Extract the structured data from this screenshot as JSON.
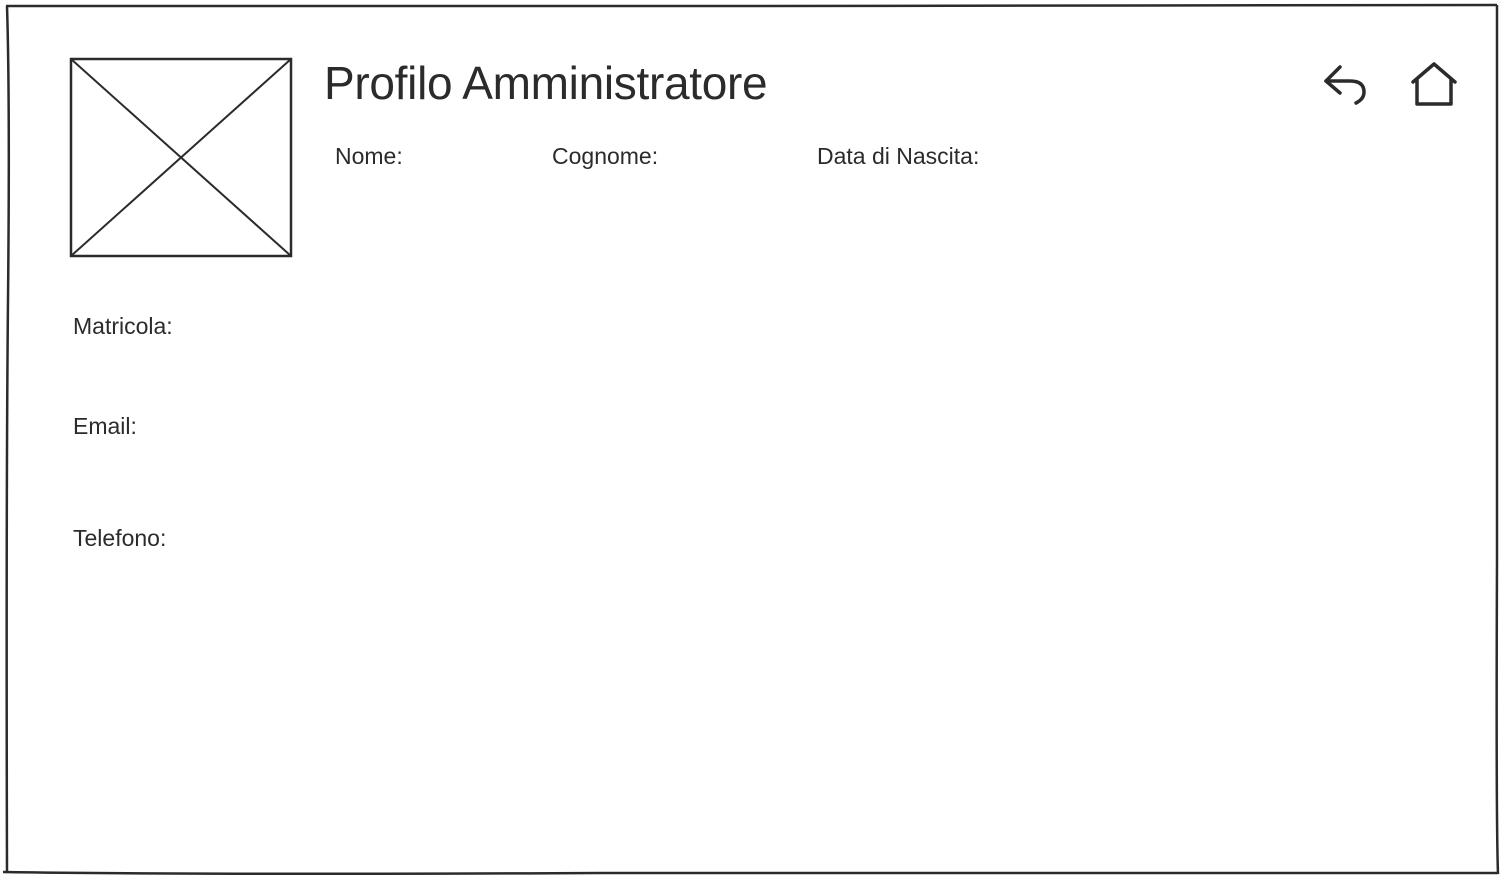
{
  "header": {
    "title": "Profilo Amministratore",
    "back_icon": "back-arrow-icon",
    "home_icon": "home-icon"
  },
  "profile": {
    "nome_label": "Nome:",
    "cognome_label": "Cognome:",
    "data_nascita_label": "Data di Nascita:",
    "matricola_label": "Matricola:",
    "email_label": "Email:",
    "telefono_label": "Telefono:"
  },
  "avatar": {
    "icon": "image-placeholder-icon"
  },
  "colors": {
    "stroke": "#2b2b2b",
    "background": "#ffffff"
  }
}
